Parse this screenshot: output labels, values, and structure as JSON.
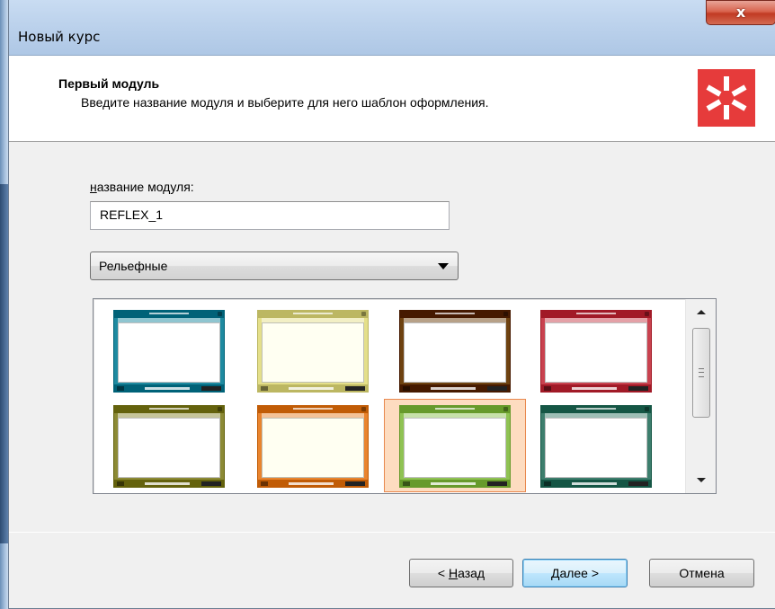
{
  "window": {
    "title": "Новый курс",
    "close_label": "x"
  },
  "header": {
    "title": "Первый модуль",
    "subtitle": "Введите название модуля и выберите для него шаблон оформления.",
    "logo_icon": "asterisk-logo-icon",
    "logo_color": "#e63b3b"
  },
  "form": {
    "name_label_accel": "н",
    "name_label_rest": "азвание модуля:",
    "name_value": "REFLEX_1",
    "style_selected": "Рельефные"
  },
  "templates": [
    {
      "color": "#1e8aa0",
      "inner": "#ffffff",
      "selected": false
    },
    {
      "color": "#e4df8a",
      "inner": "#fffff2",
      "selected": false
    },
    {
      "color": "#6e4210",
      "inner": "#ffffff",
      "selected": false
    },
    {
      "color": "#c9424f",
      "inner": "#ffffff",
      "selected": false
    },
    {
      "color": "#8c8a35",
      "inner": "#ffffff",
      "selected": false
    },
    {
      "color": "#e9842e",
      "inner": "#fffff2",
      "selected": false
    },
    {
      "color": "#8fc253",
      "inner": "#ffffff",
      "selected": true
    },
    {
      "color": "#3d7e6d",
      "inner": "#ffffff",
      "selected": false
    }
  ],
  "buttons": {
    "back_prefix": "< ",
    "back_accel": "Н",
    "back_rest": "азад",
    "next_accel": "Д",
    "next_rest": "алее >",
    "cancel": "Отмена"
  }
}
